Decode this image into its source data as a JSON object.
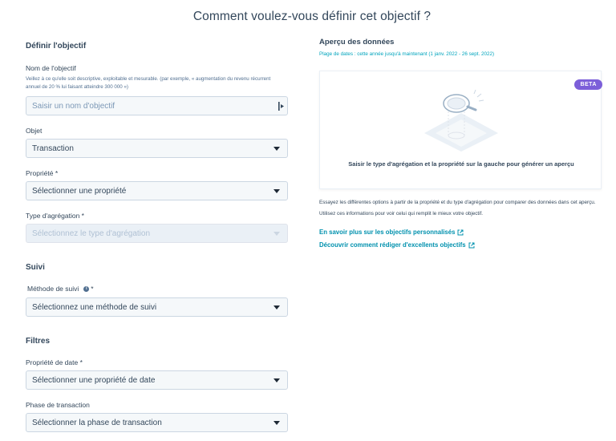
{
  "page": {
    "title": "Comment voulez-vous définir cet objectif ?"
  },
  "define": {
    "heading": "Définir l'objectif",
    "name_label": "Nom de l'objectif",
    "name_help": "Veillez à ce qu'elle soit descriptive, exploitable et mesurable. (par exemple, « augmentation du revenu récurrent annuel de 20 % lui faisant atteindre 300 000 »)",
    "name_placeholder": "Saisir un nom d'objectif",
    "object_label": "Objet",
    "object_value": "Transaction",
    "property_label": "Propriété *",
    "property_value": "Sélectionner une propriété",
    "aggregation_label": "Type d'agrégation *",
    "aggregation_value": "Sélectionnez le type d'agrégation"
  },
  "tracking": {
    "heading": "Suivi",
    "method_label": "Méthode de suivi",
    "method_required": "*",
    "method_value": "Sélectionnez une méthode de suivi"
  },
  "filters": {
    "heading": "Filtres",
    "date_label": "Propriété de date *",
    "date_value": "Sélectionner une propriété de date",
    "phase_label": "Phase de transaction",
    "phase_value": "Sélectionner la phase de transaction"
  },
  "preview": {
    "title": "Aperçu des données",
    "date_range": "Plage de dates : cette année jusqu'à maintenant (1 janv. 2022 - 26 sept. 2022)",
    "badge": "BETA",
    "card_text": "Saisir le type d'agrégation et la propriété sur la gauche pour générer un aperçu",
    "description": "Essayez les différentes options à partir de la propriété et du type d'agrégation pour comparer des données dans cet aperçu. Utilisez ces informations pour voir celui qui remplit le mieux votre objectif.",
    "link1": "En savoir plus sur les objectifs personnalisés",
    "link2": "Découvrir comment rédiger d'excellents objectifs"
  },
  "colors": {
    "link": "#0091ae",
    "badge": "#7c5fd9",
    "text": "#33475b"
  },
  "icons": [
    "cursor-icon",
    "caret-down-icon",
    "info-icon",
    "magnifier-illustration-icon",
    "external-link-icon"
  ]
}
